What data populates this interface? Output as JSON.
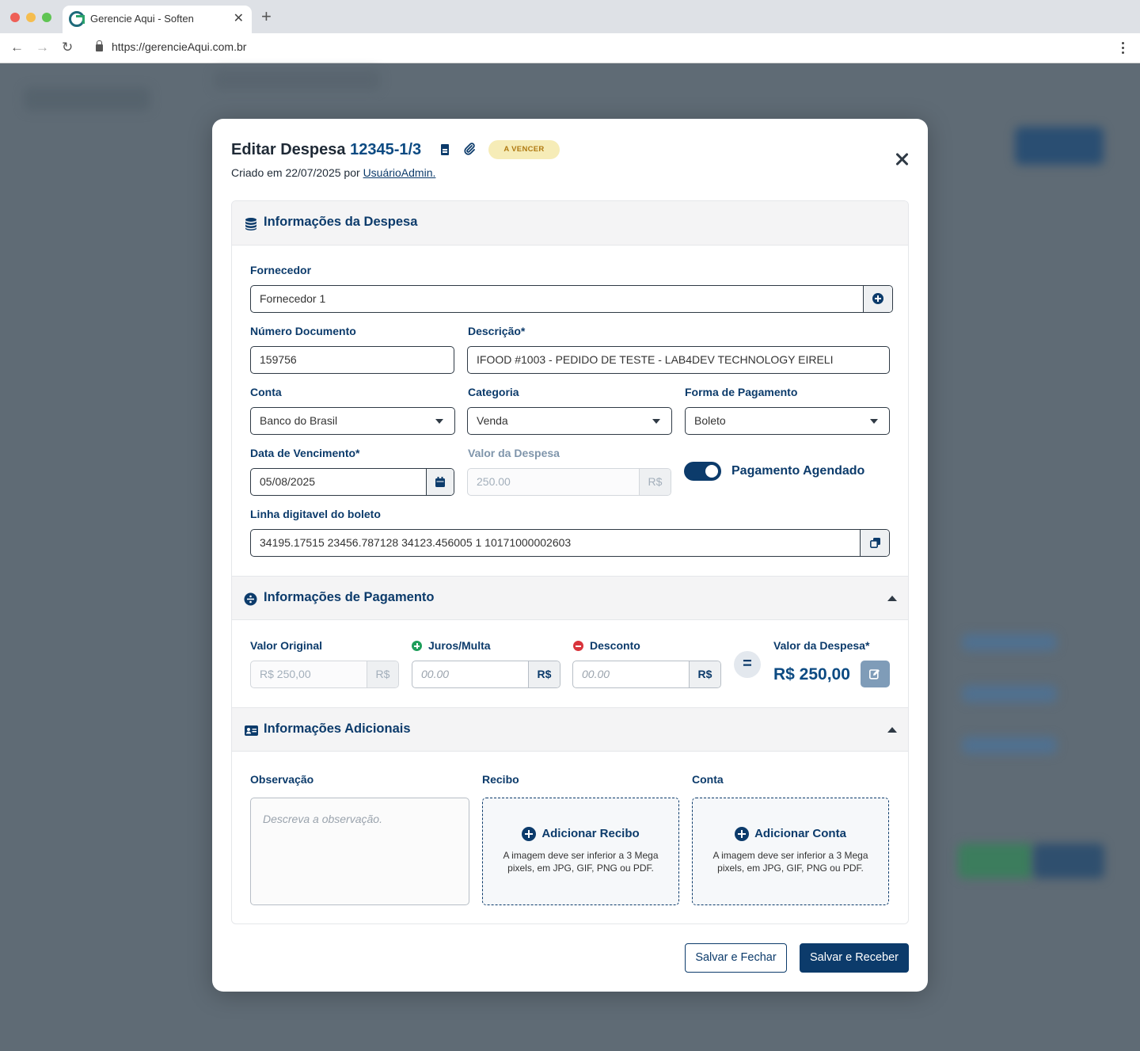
{
  "browser": {
    "tab_title": "Gerencie Aqui - Soften",
    "url": "https://gerencieAqui.com.br",
    "close_glyph": "✕",
    "new_tab_glyph": "+",
    "back_glyph": "←",
    "forward_glyph": "→",
    "reload_glyph": "↻"
  },
  "modal": {
    "title": "Editar Despesa",
    "number": "12345-1/3",
    "status_badge": "A VENCER",
    "created_prefix": "Criado em 22/07/2025 por",
    "created_user": "UsuárioAdmin.",
    "sections": {
      "expense_info": "Informações da Despesa",
      "payment_info": "Informações de Pagamento",
      "additional_info": "Informações Adicionais"
    },
    "fields": {
      "supplier": {
        "label": "Fornecedor",
        "value": "Fornecedor 1"
      },
      "doc_number": {
        "label": "Número Documento",
        "value": "159756"
      },
      "description": {
        "label": "Descrição*",
        "value": "IFOOD #1003 - PEDIDO DE TESTE - LAB4DEV TECHNOLOGY EIRELI"
      },
      "account": {
        "label": "Conta",
        "value": "Banco do Brasil"
      },
      "category": {
        "label": "Categoria",
        "value": "Venda"
      },
      "payment_method": {
        "label": "Forma de Pagamento",
        "value": "Boleto"
      },
      "due_date": {
        "label": "Data de Vencimento*",
        "value": "05/08/2025"
      },
      "expense_value": {
        "label": "Valor da Despesa",
        "value": "250.00",
        "addon": "R$"
      },
      "scheduled_payment": {
        "label": "Pagamento Agendado",
        "on": true
      },
      "barcode": {
        "label": "Linha digitavel do boleto",
        "value": "34195.17515 23456.787128 34123.456005 1 10171000002603"
      }
    },
    "payment": {
      "original": {
        "label": "Valor Original",
        "value": "R$ 250,00",
        "addon": "R$"
      },
      "interest": {
        "label": "Juros/Multa",
        "placeholder": "00.00",
        "addon": "R$"
      },
      "discount": {
        "label": "Desconto",
        "placeholder": "00.00",
        "addon": "R$"
      },
      "equals": "=",
      "total_label": "Valor da Despesa*",
      "total_value": "R$ 250,00"
    },
    "additional": {
      "note_label": "Observação",
      "note_placeholder": "Descreva a observação.",
      "receipt_label": "Recibo",
      "receipt_button": "Adicionar Recibo",
      "receipt_hint": "A imagem deve ser inferior a 3 Mega pixels, em JPG, GIF, PNG ou PDF.",
      "bill_label": "Conta",
      "bill_button": "Adicionar Conta",
      "bill_hint": "A imagem deve ser inferior a 3 Mega pixels, em JPG, GIF, PNG ou PDF."
    },
    "buttons": {
      "save_close": "Salvar e Fechar",
      "save_receive": "Salvar e Receber"
    }
  },
  "colors": {
    "primary": "#0c3b6b",
    "badge_bg": "#f6ecb7",
    "badge_text": "#b07a12",
    "interest_green": "#1e9e5a",
    "discount_red": "#d9343b",
    "overlay": "#5f6b75"
  }
}
